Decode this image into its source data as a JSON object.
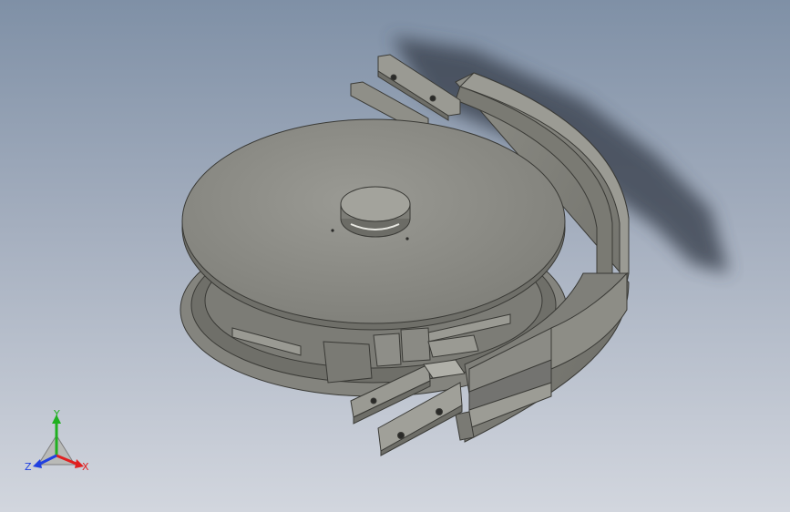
{
  "viewport": {
    "background_top": "#7f90a6",
    "background_bottom": "#d2d6de",
    "part_color": "#8a8a84",
    "part_edge_color": "#3a3a36",
    "shadow_color": "#3b4250"
  },
  "triad": {
    "x_label": "X",
    "y_label": "Y",
    "z_label": "Z",
    "x_color": "#e02020",
    "y_color": "#20b020",
    "z_color": "#2040e0"
  }
}
